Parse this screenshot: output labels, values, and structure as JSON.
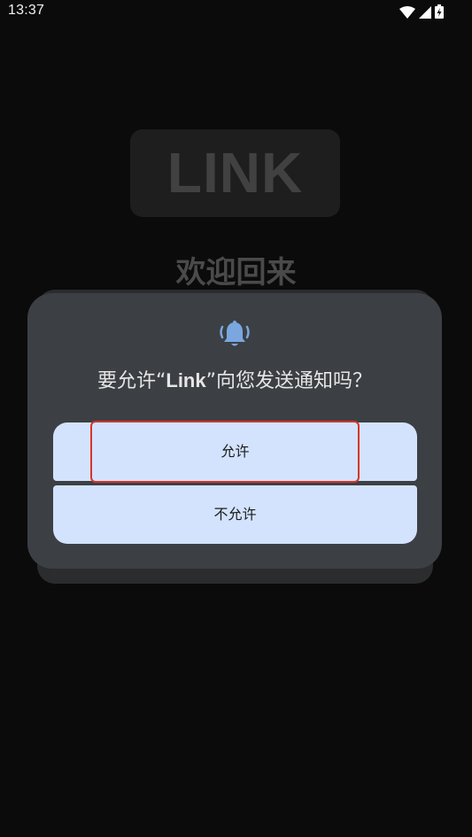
{
  "status_bar": {
    "time": "13:37",
    "icons": [
      "wifi-icon",
      "cellular-signal-icon",
      "battery-charging-icon"
    ]
  },
  "background": {
    "logo": "LINK",
    "welcome": "欢迎回来"
  },
  "dialog": {
    "icon": "notification-bell-icon",
    "title_prefix": "要允许“",
    "title_app": "Link",
    "title_suffix": "”向您发送通知吗？",
    "allow_label": "允许",
    "deny_label": "不允许"
  },
  "colors": {
    "dialog_bg": "#3c3f43",
    "button_bg": "#d3e3fd",
    "bell": "#7aa7e0",
    "highlight": "#d8342b"
  }
}
